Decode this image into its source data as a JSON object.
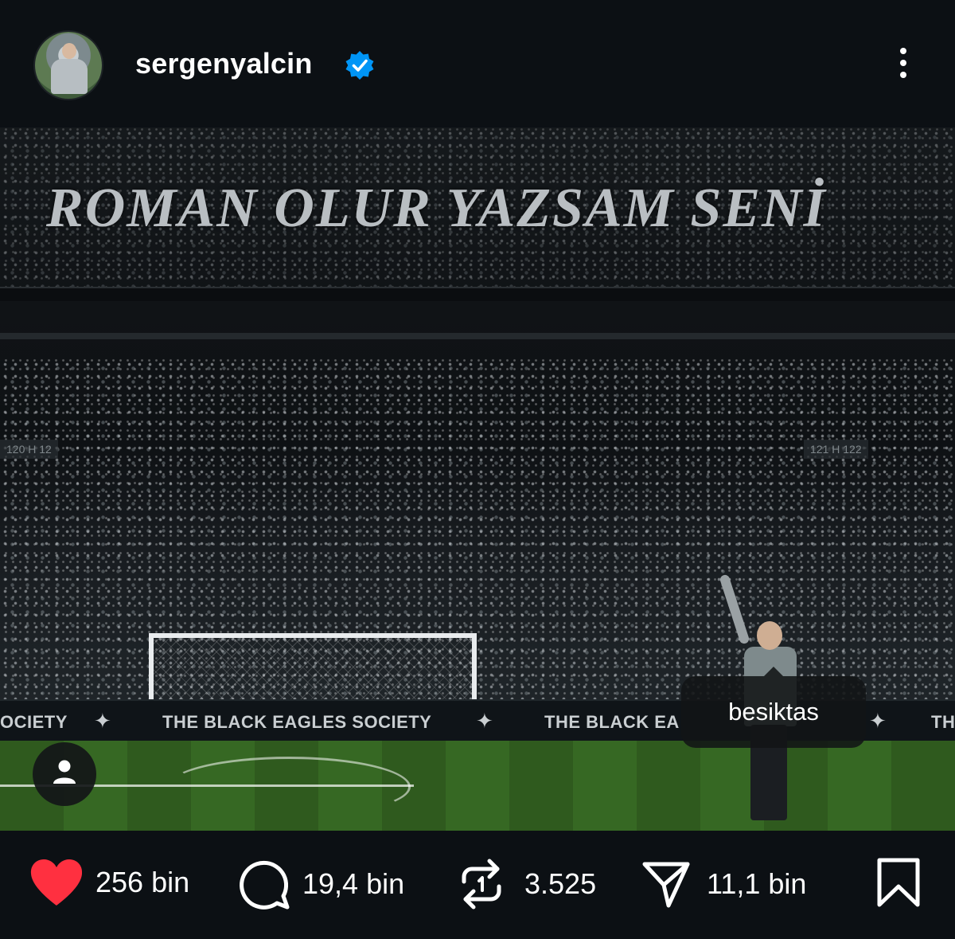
{
  "header": {
    "username": "sergenyalcin",
    "verified": true,
    "avatar_icon": "profile-photo",
    "more_icon": "more-vertical-icon"
  },
  "photo": {
    "banner_text": "ROMAN OLUR YAZSAM SENİ",
    "section_left": "120 H 12",
    "section_right": "121 H 122",
    "ad_texts": [
      "OCIETY",
      "THE BLACK EAGLES SOCIETY",
      "THE BLACK EA",
      "TH"
    ],
    "tag_label": "besiktas",
    "tagged_icon": "person-icon"
  },
  "actions": {
    "like_count": "256 bin",
    "comment_count": "19,4 bin",
    "repost_count": "3.525",
    "share_count": "11,1 bin",
    "liked": true,
    "colors": {
      "heart": "#ff3040",
      "text": "#ffffff",
      "verified": "#0095f6"
    }
  }
}
